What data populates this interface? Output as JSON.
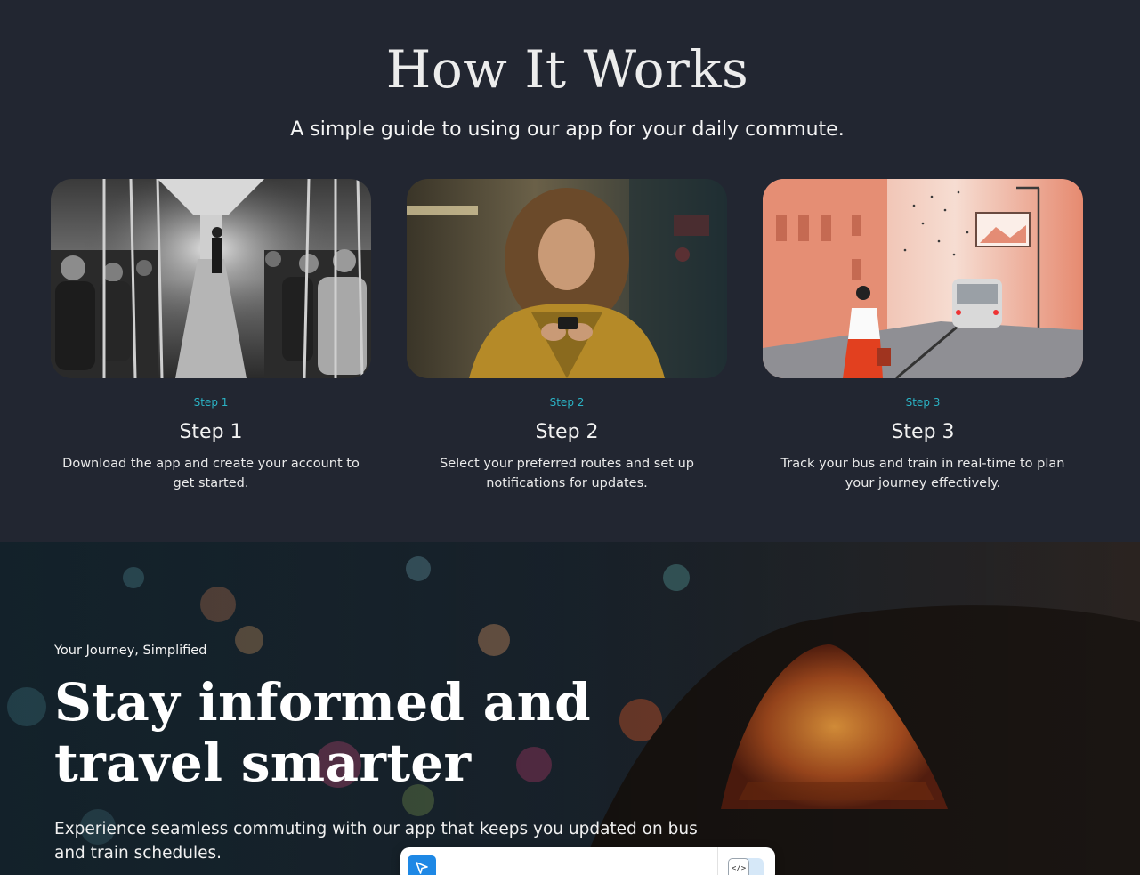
{
  "how_it_works": {
    "title": "How It Works",
    "subtitle": "A simple guide to using our app for your daily commute.",
    "steps": [
      {
        "eyebrow": "Step 1",
        "title": "Step 1",
        "description": "Download the app and create your account to get started.",
        "image": "subway-car-photo"
      },
      {
        "eyebrow": "Step 2",
        "title": "Step 2",
        "description": "Select your preferred routes and set up notifications for updates.",
        "image": "woman-with-phone-photo"
      },
      {
        "eyebrow": "Step 3",
        "title": "Step 3",
        "description": "Track your bus and train in real-time to plan your journey effectively.",
        "image": "street-bus-illustration"
      }
    ]
  },
  "hero": {
    "eyebrow": "Your Journey, Simplified",
    "title": "Stay informed and travel smarter",
    "description": "Experience seamless commuting with our app that keeps you updated on bus and train schedules.",
    "background": "car-taillight-night-photo"
  },
  "widget": {
    "cursor_icon": "cursor-arrow-icon",
    "code_icon": "code-icon",
    "code_glyph": "</>"
  },
  "colors": {
    "background": "#222631",
    "accent": "#2bb3c5",
    "widget_blue": "#1e88e5"
  }
}
